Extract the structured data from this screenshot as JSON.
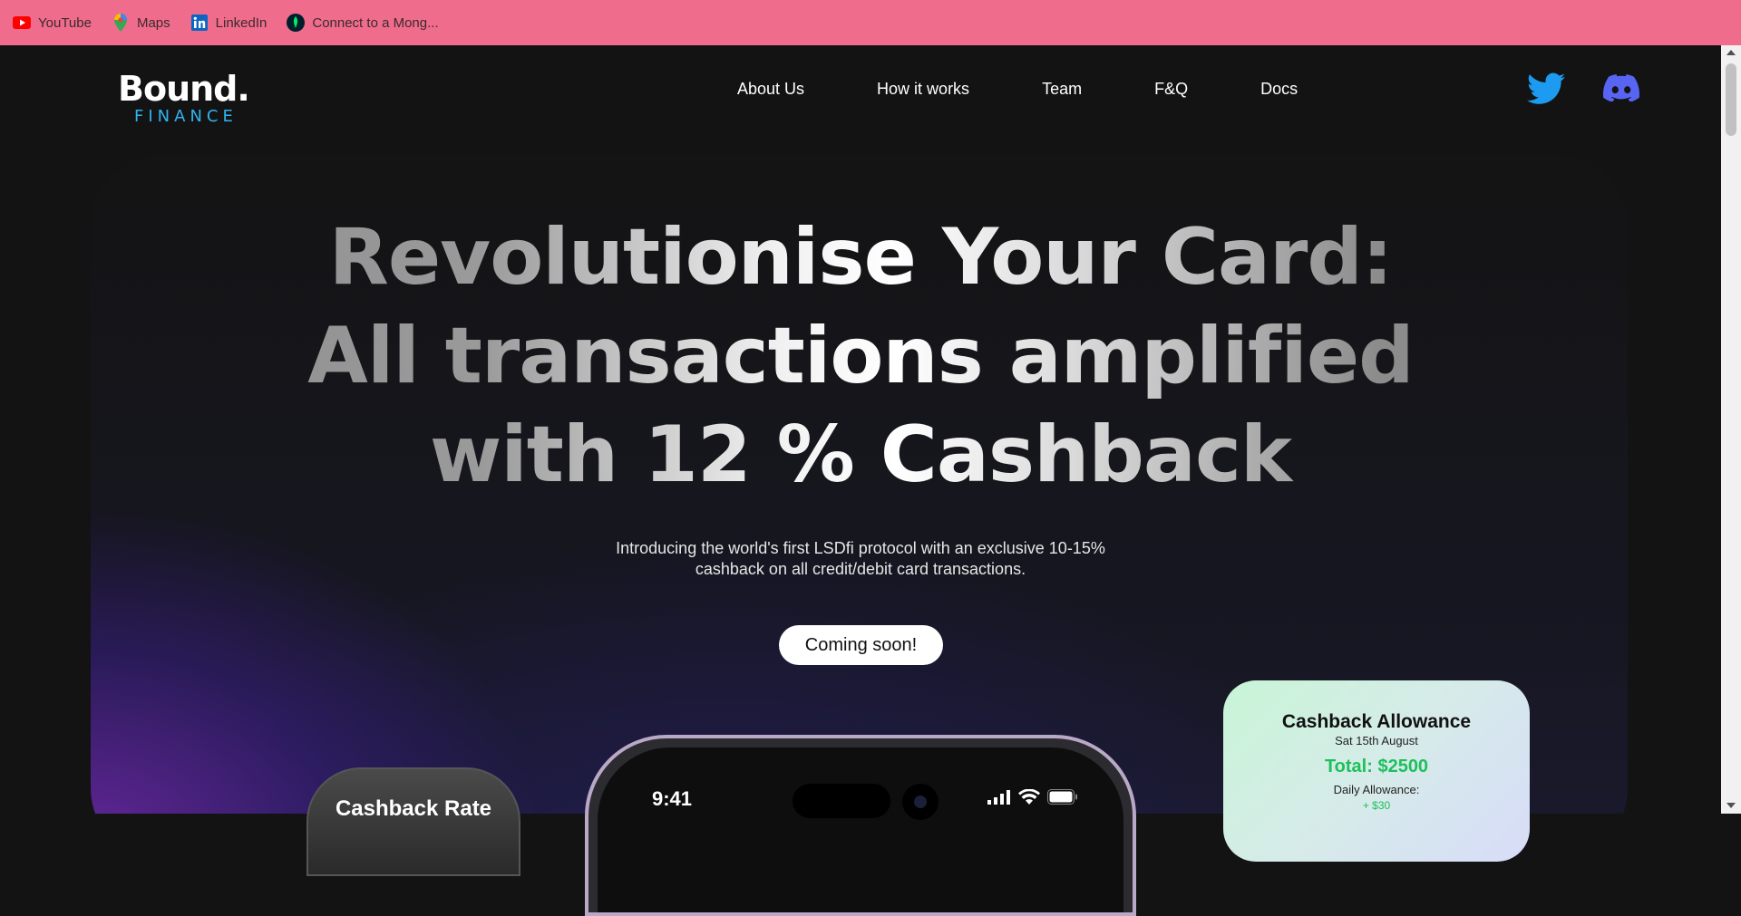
{
  "bookmarks": [
    {
      "label": "YouTube",
      "icon": "youtube-icon"
    },
    {
      "label": "Maps",
      "icon": "maps-icon"
    },
    {
      "label": "LinkedIn",
      "icon": "linkedin-icon"
    },
    {
      "label": "Connect to a Mong...",
      "icon": "mongodb-icon"
    }
  ],
  "brand": {
    "name": "Bound.",
    "tagline": "FINANCE",
    "tagline_color": "#2fb4f0"
  },
  "nav": [
    "About Us",
    "How it works",
    "Team",
    "F&Q",
    "Docs"
  ],
  "social": {
    "twitter": "twitter-icon",
    "discord": "discord-icon",
    "twitter_color": "#1d9bf0",
    "discord_color": "#5865f2"
  },
  "hero": {
    "line1": "Revolutionise Your Card:",
    "line2": "All transactions amplified",
    "line3": "with 12 % Cashback",
    "subtitle1": "Introducing the world's first LSDfi protocol with an exclusive 10-15%",
    "subtitle2": "cashback on all credit/debit card transactions.",
    "cta": "Coming soon!"
  },
  "cashback_rate_card": {
    "title": "Cashback Rate"
  },
  "phone": {
    "time": "9:41"
  },
  "allowance_card": {
    "title": "Cashback Allowance",
    "date": "Sat 15th August",
    "total": "Total: $2500",
    "daily_label": "Daily Allowance:",
    "daily_value": "+ $30",
    "accent": "#1ec05c"
  },
  "colors": {
    "bookmark_bar": "#f06c8c",
    "background": "#131313"
  }
}
